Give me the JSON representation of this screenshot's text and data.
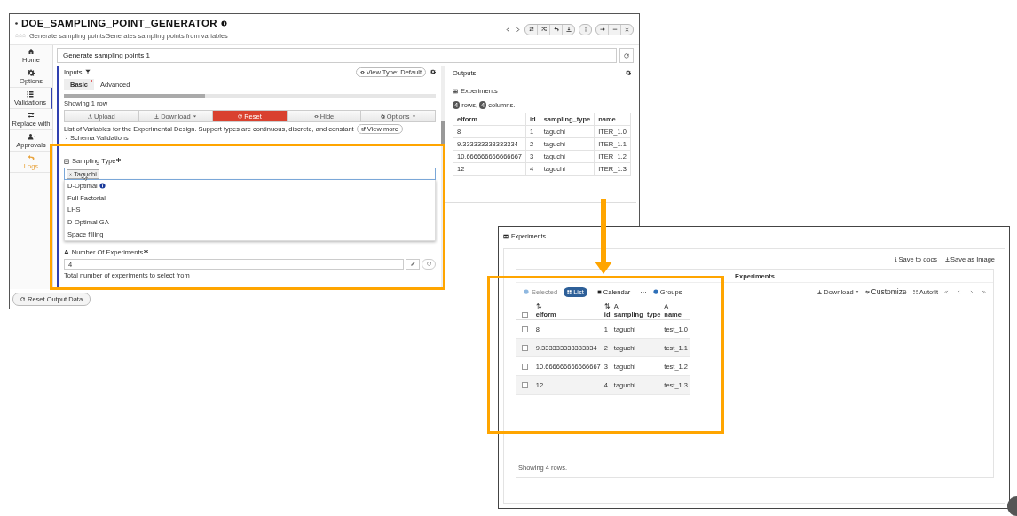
{
  "doe_window": {
    "title": "DOE_SAMPLING_POINT_GENERATOR",
    "subtitle": "Generate sampling pointsGenerates sampling points from variables",
    "sidebar": [
      {
        "label": "Home",
        "selected": false,
        "color": "#333333"
      },
      {
        "label": "Options",
        "selected": false,
        "color": "#333333"
      },
      {
        "label": "Validations",
        "selected": true,
        "color": "#333333"
      },
      {
        "label": "Replace with",
        "selected": false,
        "color": "#333333"
      },
      {
        "label": "Approvals",
        "selected": false,
        "color": "#333333"
      },
      {
        "label": "Logs",
        "selected": false,
        "color": "#e8a33d"
      }
    ],
    "name_field": {
      "value": "Generate sampling points 1"
    },
    "inputs": {
      "title": "Inputs",
      "view_type": "View Type: Default",
      "tabs": [
        {
          "label": "Basic",
          "selected": true,
          "required": true
        },
        {
          "label": "Advanced",
          "selected": false,
          "required": false
        }
      ],
      "row_status": "Showing 1 row",
      "actions": [
        {
          "label": "Upload",
          "kind": "plain",
          "dropdown": false
        },
        {
          "label": "Download",
          "kind": "plain",
          "dropdown": true
        },
        {
          "label": "Reset",
          "kind": "danger",
          "dropdown": false
        },
        {
          "label": "Hide",
          "kind": "plain",
          "dropdown": false
        },
        {
          "label": "Options",
          "kind": "plain",
          "dropdown": true
        }
      ],
      "description": "List of Variables for the Experimental Design. Support types are continuous, discrete, and constant",
      "view_more": "View more",
      "schema_validations": "Schema Validations",
      "sampling_type": {
        "label": "Sampling Type",
        "required": true,
        "value": "Taguchi",
        "options": [
          {
            "label": "D-Optimal",
            "info": true
          },
          {
            "label": "Full Factorial",
            "info": false
          },
          {
            "label": "LHS",
            "info": false
          },
          {
            "label": "D-Optimal GA",
            "info": false
          },
          {
            "label": "Space filling",
            "info": false
          }
        ]
      },
      "experiments": {
        "type_icon": "A",
        "label": "Number Of Experiments",
        "required": true,
        "value": "4",
        "help": "Total number of experiments to select from"
      }
    },
    "reset_button": "Reset Output Data",
    "outputs": {
      "title": "Outputs",
      "table_title": "Experiments",
      "row_count": "4",
      "row_word": "rows,",
      "column_count": "4",
      "column_word": "columns.",
      "columns": [
        "elform",
        "id",
        "sampling_type",
        "name"
      ],
      "rows": [
        [
          "8",
          "1",
          "taguchi",
          "ITER_1.0"
        ],
        [
          "9.333333333333334",
          "2",
          "taguchi",
          "ITER_1.1"
        ],
        [
          "10.666666666666667",
          "3",
          "taguchi",
          "ITER_1.2"
        ],
        [
          "12",
          "4",
          "taguchi",
          "ITER_1.3"
        ]
      ]
    }
  },
  "experiments_window": {
    "title": "Experiments",
    "links": [
      "Save to docs",
      "Save as Image"
    ],
    "card_title": "Experiments",
    "selected_filter": "Selected",
    "views": [
      {
        "label": "List",
        "selected": true
      },
      {
        "label": "Calendar",
        "selected": false
      }
    ],
    "more": "···",
    "groups": "Groups",
    "download": "Download",
    "customize": "Customize",
    "autofit": "Autofit",
    "all_checked": false,
    "columns": [
      {
        "type_icon": "⇅",
        "label": "elform"
      },
      {
        "type_icon": "⇅",
        "label": "id"
      },
      {
        "type_icon": "A",
        "label": "sampling_type"
      },
      {
        "type_icon": "A",
        "label": "name"
      }
    ],
    "rows": [
      {
        "checked": false,
        "cells": [
          "8",
          "1",
          "taguchi",
          "test_1.0"
        ]
      },
      {
        "checked": false,
        "cells": [
          "9.333333333333334",
          "2",
          "taguchi",
          "test_1.1"
        ]
      },
      {
        "checked": false,
        "cells": [
          "10.666666666666667",
          "3",
          "taguchi",
          "test_1.2"
        ]
      },
      {
        "checked": false,
        "cells": [
          "12",
          "4",
          "taguchi",
          "test_1.3"
        ]
      }
    ],
    "footer": "Showing 4 rows."
  }
}
